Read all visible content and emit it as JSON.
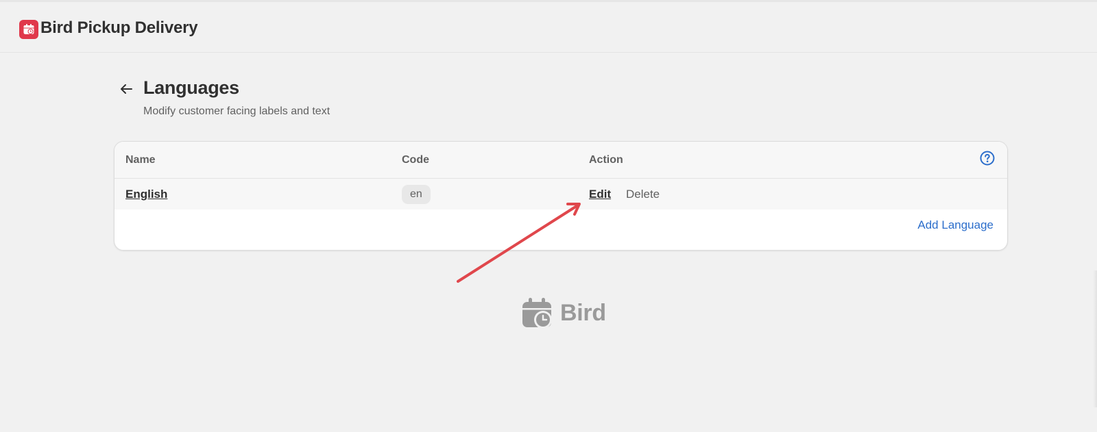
{
  "app": {
    "title": "Bird Pickup Delivery",
    "brand_color": "#e0384b"
  },
  "page": {
    "title": "Languages",
    "subtitle": "Modify customer facing labels and text",
    "back_icon": "arrow-left-icon"
  },
  "table": {
    "columns": [
      "Name",
      "Code",
      "Action"
    ],
    "help_icon": "question-circle-icon",
    "rows": [
      {
        "name": "English",
        "code": "en",
        "edit_label": "Edit",
        "delete_label": "Delete"
      }
    ],
    "add_label": "Add Language",
    "link_color": "#2c6ecb"
  },
  "annotation": {
    "arrow_color": "#e0474c",
    "arrow_icon": "annotation-arrow-icon"
  },
  "footer": {
    "brand": "Bird",
    "logo_icon": "calendar-clock-icon"
  }
}
